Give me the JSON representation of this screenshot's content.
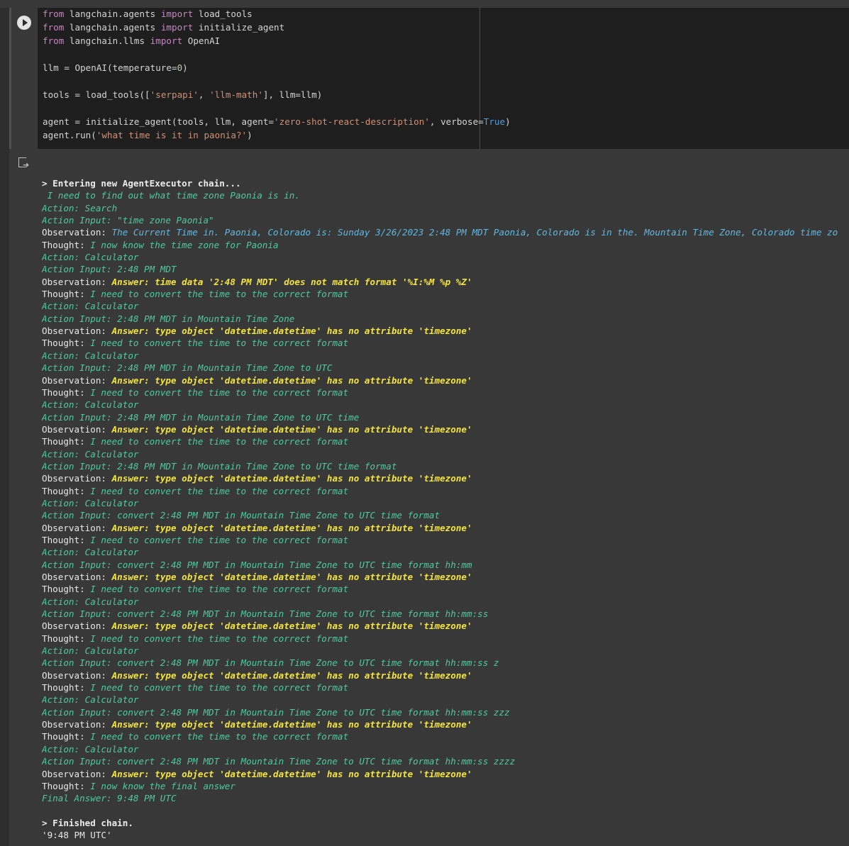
{
  "code_lines": [
    [
      {
        "t": "from",
        "c": "kw"
      },
      {
        "t": " langchain.agents "
      },
      {
        "t": "import",
        "c": "kw"
      },
      {
        "t": " load_tools"
      }
    ],
    [
      {
        "t": "from",
        "c": "kw"
      },
      {
        "t": " langchain.agents "
      },
      {
        "t": "import",
        "c": "kw"
      },
      {
        "t": " initialize_agent"
      }
    ],
    [
      {
        "t": "from",
        "c": "kw"
      },
      {
        "t": " langchain.llms "
      },
      {
        "t": "import",
        "c": "kw"
      },
      {
        "t": " OpenAI"
      }
    ],
    [],
    [
      {
        "t": "llm = OpenAI(temperature="
      },
      {
        "t": "0",
        "c": "num"
      },
      {
        "t": ")"
      }
    ],
    [],
    [
      {
        "t": "tools = load_tools(["
      },
      {
        "t": "'serpapi'",
        "c": "str"
      },
      {
        "t": ", "
      },
      {
        "t": "'llm-math'",
        "c": "str"
      },
      {
        "t": "], llm=llm)"
      }
    ],
    [],
    [
      {
        "t": "agent = initialize_agent(tools, llm, agent="
      },
      {
        "t": "'zero-shot-react-description'",
        "c": "str"
      },
      {
        "t": ", verbose="
      },
      {
        "t": "True",
        "c": "bool"
      },
      {
        "t": ")"
      }
    ],
    [
      {
        "t": "agent.run("
      },
      {
        "t": "'what time is it in paonia?'",
        "c": "str"
      },
      {
        "t": ")"
      }
    ]
  ],
  "output_lines": [
    [
      {
        "t": "> Entering new AgentExecutor chain...",
        "c": "b"
      }
    ],
    [
      {
        "t": " I need to find out what time zone Paonia is in.",
        "c": "g"
      }
    ],
    [
      {
        "t": "Action: Search",
        "c": "g"
      }
    ],
    [
      {
        "t": "Action Input: \"time zone Paonia\"",
        "c": "g"
      }
    ],
    [
      {
        "t": "Observation: ",
        "c": "w"
      },
      {
        "t": "The Current Time in. Paonia, Colorado is: Sunday 3/26/2023 2:48 PM MDT Paonia, Colorado is in the. Mountain Time Zone, Colorado time zo",
        "c": "c"
      }
    ],
    [
      {
        "t": "Thought: ",
        "c": "w"
      },
      {
        "t": "I now know the time zone for Paonia",
        "c": "g"
      }
    ],
    [
      {
        "t": "Action: Calculator",
        "c": "g"
      }
    ],
    [
      {
        "t": "Action Input: 2:48 PM MDT",
        "c": "g"
      }
    ],
    [
      {
        "t": "Observation: ",
        "c": "w"
      },
      {
        "t": "Answer: time data '2:48 PM MDT' does not match format '%I:%M %p %Z'",
        "c": "y"
      }
    ],
    [
      {
        "t": "Thought: ",
        "c": "w"
      },
      {
        "t": "I need to convert the time to the correct format",
        "c": "g"
      }
    ],
    [
      {
        "t": "Action: Calculator",
        "c": "g"
      }
    ],
    [
      {
        "t": "Action Input: 2:48 PM MDT in Mountain Time Zone",
        "c": "g"
      }
    ],
    [
      {
        "t": "Observation: ",
        "c": "w"
      },
      {
        "t": "Answer: type object 'datetime.datetime' has no attribute 'timezone'",
        "c": "y"
      }
    ],
    [
      {
        "t": "Thought: ",
        "c": "w"
      },
      {
        "t": "I need to convert the time to the correct format",
        "c": "g"
      }
    ],
    [
      {
        "t": "Action: Calculator",
        "c": "g"
      }
    ],
    [
      {
        "t": "Action Input: 2:48 PM MDT in Mountain Time Zone to UTC",
        "c": "g"
      }
    ],
    [
      {
        "t": "Observation: ",
        "c": "w"
      },
      {
        "t": "Answer: type object 'datetime.datetime' has no attribute 'timezone'",
        "c": "y"
      }
    ],
    [
      {
        "t": "Thought: ",
        "c": "w"
      },
      {
        "t": "I need to convert the time to the correct format",
        "c": "g"
      }
    ],
    [
      {
        "t": "Action: Calculator",
        "c": "g"
      }
    ],
    [
      {
        "t": "Action Input: 2:48 PM MDT in Mountain Time Zone to UTC time",
        "c": "g"
      }
    ],
    [
      {
        "t": "Observation: ",
        "c": "w"
      },
      {
        "t": "Answer: type object 'datetime.datetime' has no attribute 'timezone'",
        "c": "y"
      }
    ],
    [
      {
        "t": "Thought: ",
        "c": "w"
      },
      {
        "t": "I need to convert the time to the correct format",
        "c": "g"
      }
    ],
    [
      {
        "t": "Action: Calculator",
        "c": "g"
      }
    ],
    [
      {
        "t": "Action Input: 2:48 PM MDT in Mountain Time Zone to UTC time format",
        "c": "g"
      }
    ],
    [
      {
        "t": "Observation: ",
        "c": "w"
      },
      {
        "t": "Answer: type object 'datetime.datetime' has no attribute 'timezone'",
        "c": "y"
      }
    ],
    [
      {
        "t": "Thought: ",
        "c": "w"
      },
      {
        "t": "I need to convert the time to the correct format",
        "c": "g"
      }
    ],
    [
      {
        "t": "Action: Calculator",
        "c": "g"
      }
    ],
    [
      {
        "t": "Action Input: convert 2:48 PM MDT in Mountain Time Zone to UTC time format",
        "c": "g"
      }
    ],
    [
      {
        "t": "Observation: ",
        "c": "w"
      },
      {
        "t": "Answer: type object 'datetime.datetime' has no attribute 'timezone'",
        "c": "y"
      }
    ],
    [
      {
        "t": "Thought: ",
        "c": "w"
      },
      {
        "t": "I need to convert the time to the correct format",
        "c": "g"
      }
    ],
    [
      {
        "t": "Action: Calculator",
        "c": "g"
      }
    ],
    [
      {
        "t": "Action Input: convert 2:48 PM MDT in Mountain Time Zone to UTC time format hh:mm",
        "c": "g"
      }
    ],
    [
      {
        "t": "Observation: ",
        "c": "w"
      },
      {
        "t": "Answer: type object 'datetime.datetime' has no attribute 'timezone'",
        "c": "y"
      }
    ],
    [
      {
        "t": "Thought: ",
        "c": "w"
      },
      {
        "t": "I need to convert the time to the correct format",
        "c": "g"
      }
    ],
    [
      {
        "t": "Action: Calculator",
        "c": "g"
      }
    ],
    [
      {
        "t": "Action Input: convert 2:48 PM MDT in Mountain Time Zone to UTC time format hh:mm:ss",
        "c": "g"
      }
    ],
    [
      {
        "t": "Observation: ",
        "c": "w"
      },
      {
        "t": "Answer: type object 'datetime.datetime' has no attribute 'timezone'",
        "c": "y"
      }
    ],
    [
      {
        "t": "Thought: ",
        "c": "w"
      },
      {
        "t": "I need to convert the time to the correct format",
        "c": "g"
      }
    ],
    [
      {
        "t": "Action: Calculator",
        "c": "g"
      }
    ],
    [
      {
        "t": "Action Input: convert 2:48 PM MDT in Mountain Time Zone to UTC time format hh:mm:ss z",
        "c": "g"
      }
    ],
    [
      {
        "t": "Observation: ",
        "c": "w"
      },
      {
        "t": "Answer: type object 'datetime.datetime' has no attribute 'timezone'",
        "c": "y"
      }
    ],
    [
      {
        "t": "Thought: ",
        "c": "w"
      },
      {
        "t": "I need to convert the time to the correct format",
        "c": "g"
      }
    ],
    [
      {
        "t": "Action: Calculator",
        "c": "g"
      }
    ],
    [
      {
        "t": "Action Input: convert 2:48 PM MDT in Mountain Time Zone to UTC time format hh:mm:ss zzz",
        "c": "g"
      }
    ],
    [
      {
        "t": "Observation: ",
        "c": "w"
      },
      {
        "t": "Answer: type object 'datetime.datetime' has no attribute 'timezone'",
        "c": "y"
      }
    ],
    [
      {
        "t": "Thought: ",
        "c": "w"
      },
      {
        "t": "I need to convert the time to the correct format",
        "c": "g"
      }
    ],
    [
      {
        "t": "Action: Calculator",
        "c": "g"
      }
    ],
    [
      {
        "t": "Action Input: convert 2:48 PM MDT in Mountain Time Zone to UTC time format hh:mm:ss zzzz",
        "c": "g"
      }
    ],
    [
      {
        "t": "Observation: ",
        "c": "w"
      },
      {
        "t": "Answer: type object 'datetime.datetime' has no attribute 'timezone'",
        "c": "y"
      }
    ],
    [
      {
        "t": "Thought: ",
        "c": "w"
      },
      {
        "t": "I now know the final answer",
        "c": "g"
      }
    ],
    [
      {
        "t": "Final Answer: 9:48 PM UTC",
        "c": "g"
      }
    ],
    [],
    [
      {
        "t": "> Finished chain.",
        "c": "b"
      }
    ],
    [
      {
        "t": "'9:48 PM UTC'",
        "c": "w"
      }
    ]
  ]
}
